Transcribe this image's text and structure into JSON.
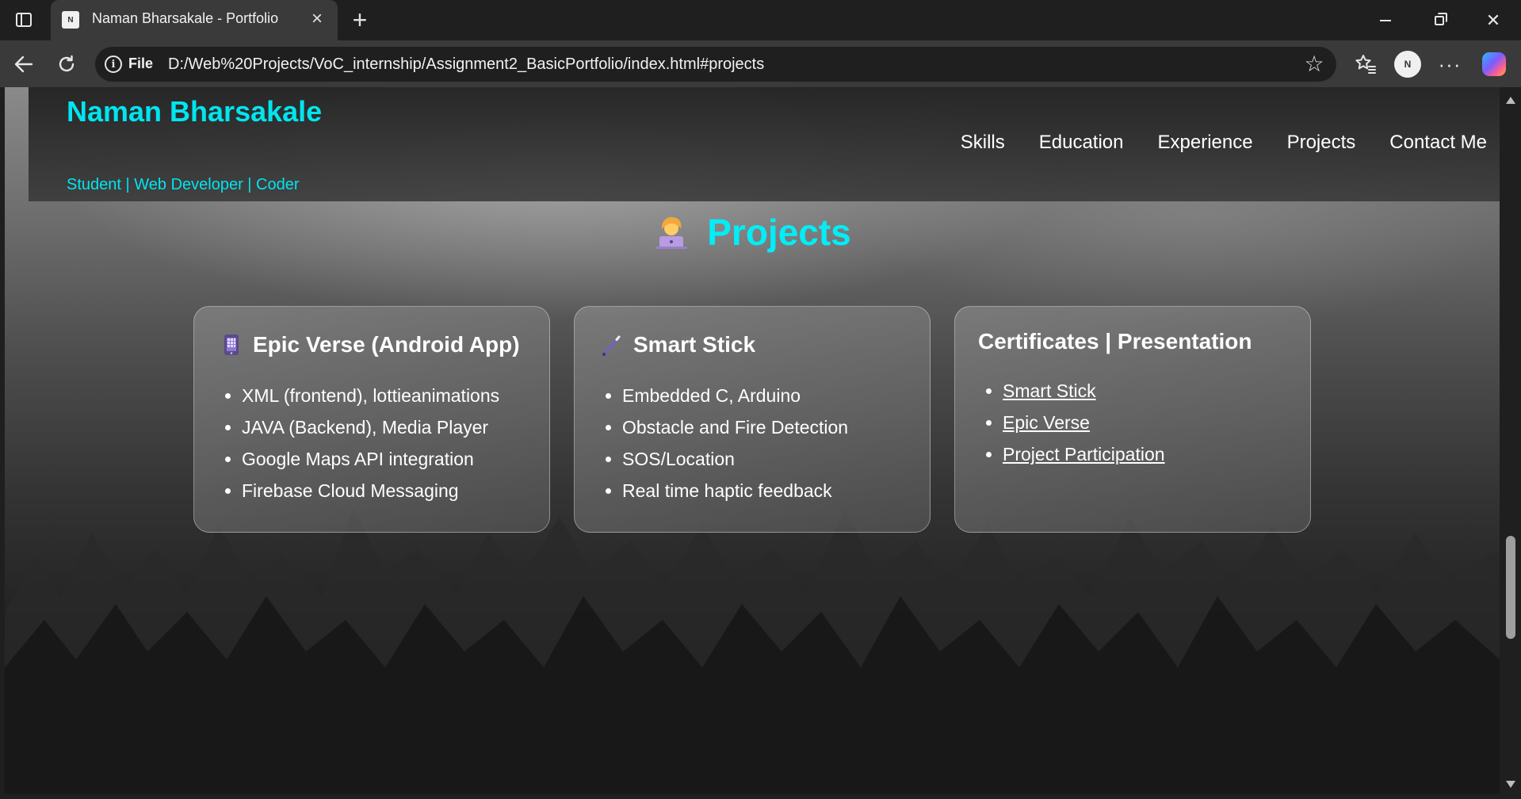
{
  "browser": {
    "tab_title": "Naman Bharsakale - Portfolio",
    "url_protocol": "File",
    "url": "D:/Web%20Projects/VoC_internship/Assignment2_BasicPortfolio/index.html#projects",
    "profile_initials": "N"
  },
  "header": {
    "name": "Naman Bharsakale",
    "tagline": "Student | Web Developer | Coder",
    "nav": [
      "Skills",
      "Education",
      "Experience",
      "Projects",
      "Contact Me"
    ]
  },
  "projects": {
    "title": "Projects",
    "cards": [
      {
        "title": "Epic Verse (Android App)",
        "icon": "mobile-phone-icon",
        "items": [
          "XML (frontend), lottieanimations",
          "JAVA (Backend), Media Player",
          "Google Maps API integration",
          "Firebase Cloud Messaging"
        ]
      },
      {
        "title": "Smart Stick",
        "icon": "probing-cane-icon",
        "items": [
          "Embedded C, Arduino",
          "Obstacle and Fire Detection",
          "SOS/Location",
          "Real time haptic feedback"
        ]
      },
      {
        "title": "Certificates | Presentation",
        "links": [
          "Smart Stick",
          "Epic Verse",
          "Project Participation"
        ]
      }
    ]
  },
  "colors": {
    "accent": "#00e5f0",
    "chrome_bg": "#1f1f1f",
    "toolbar_bg": "#3a3a3a"
  }
}
